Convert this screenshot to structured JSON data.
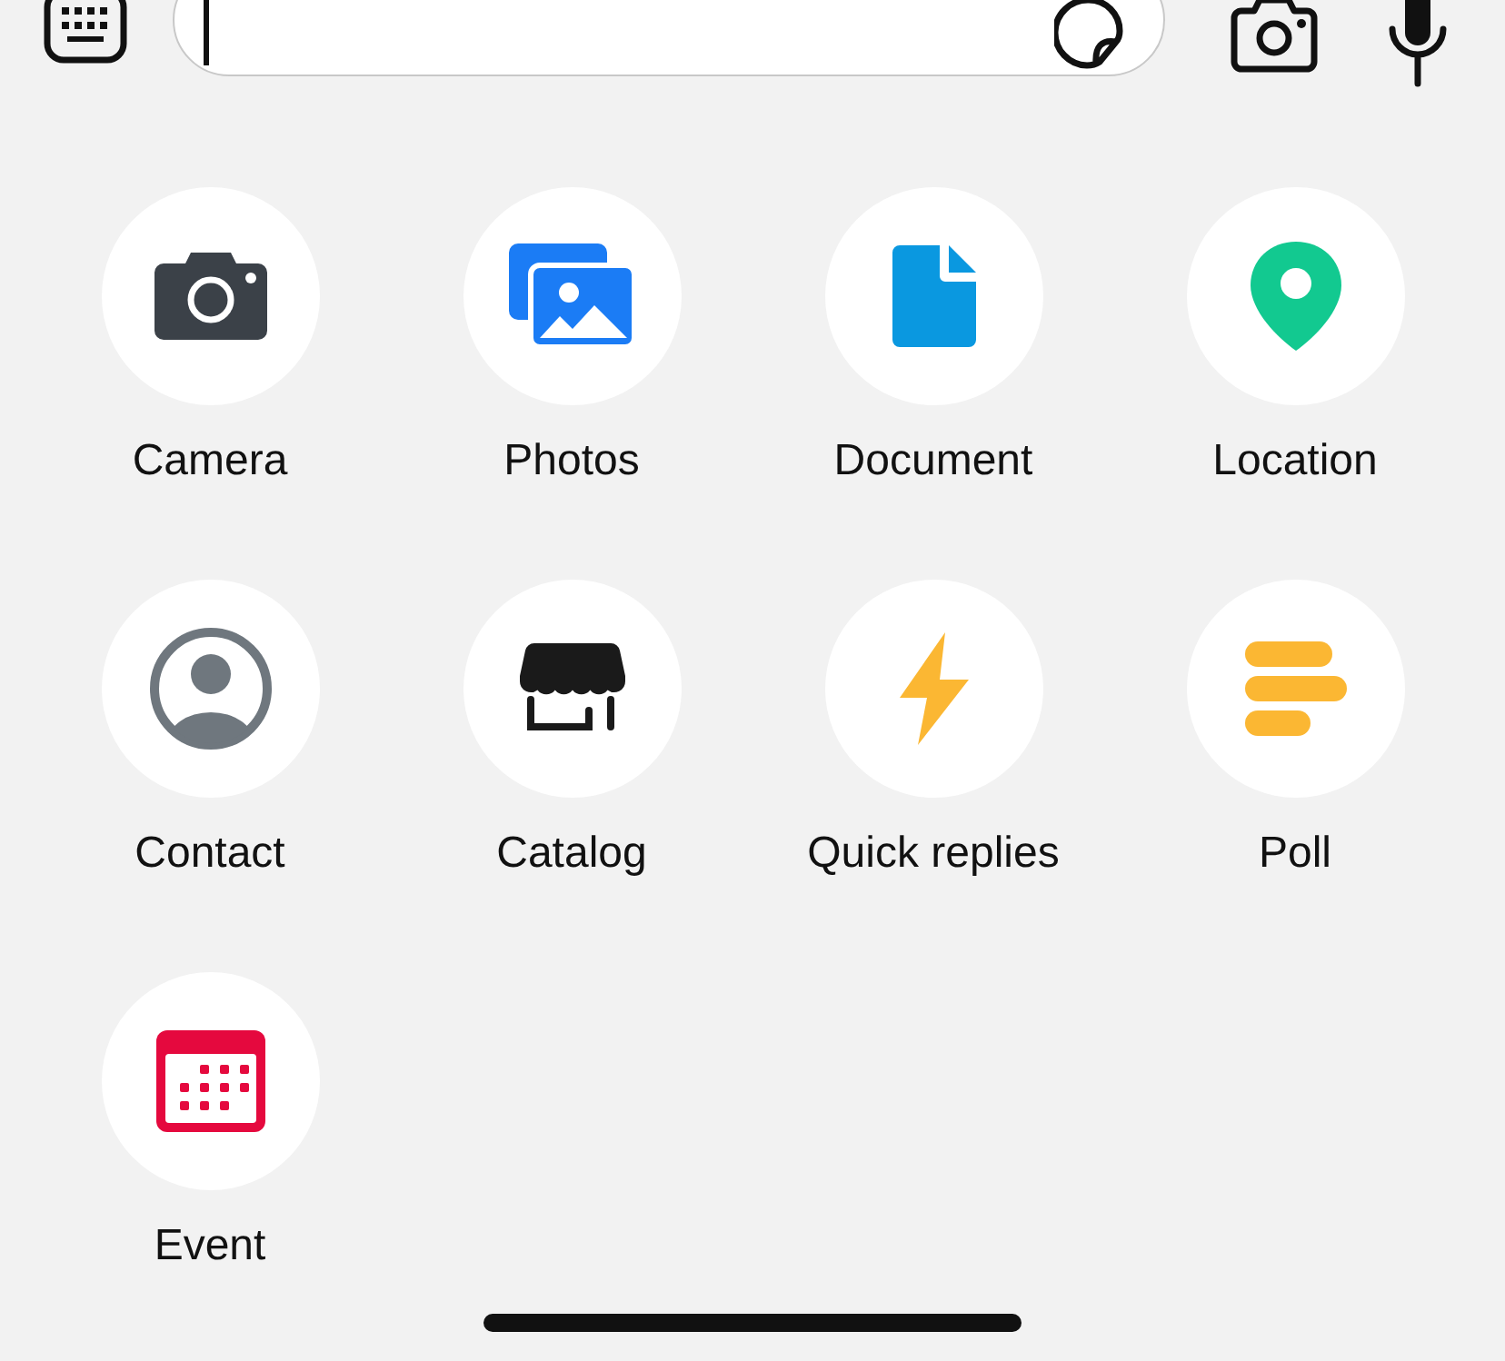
{
  "attachments": [
    {
      "label": "Camera"
    },
    {
      "label": "Photos"
    },
    {
      "label": "Document"
    },
    {
      "label": "Location"
    },
    {
      "label": "Contact"
    },
    {
      "label": "Catalog"
    },
    {
      "label": "Quick replies"
    },
    {
      "label": "Poll"
    },
    {
      "label": "Event"
    }
  ]
}
